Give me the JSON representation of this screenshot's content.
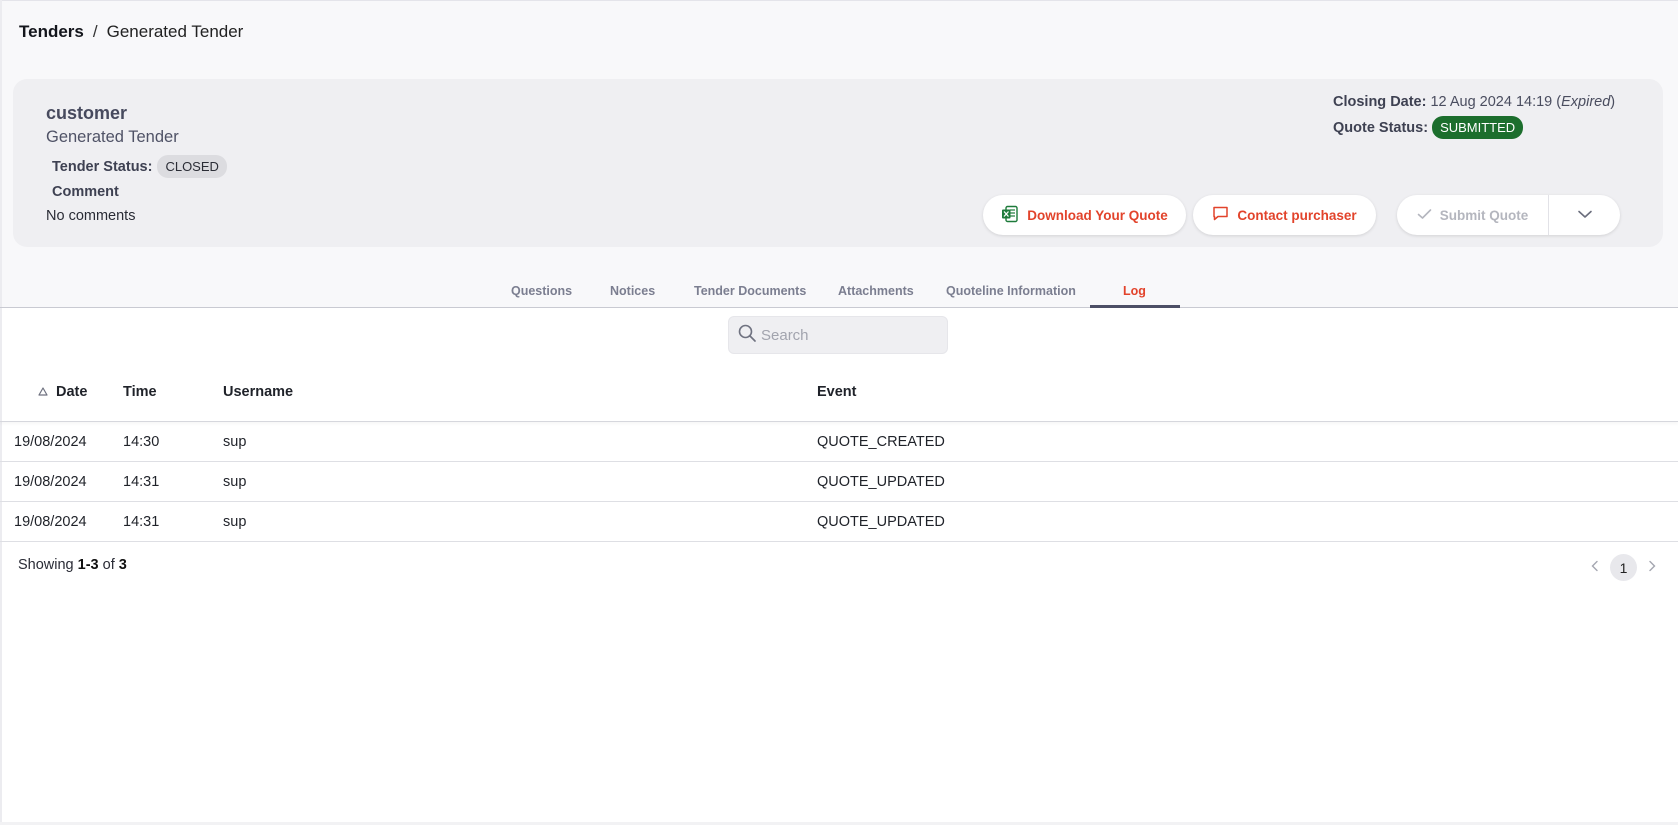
{
  "breadcrumb": {
    "root": "Tenders",
    "separator": "/",
    "current": "Generated Tender"
  },
  "header": {
    "customer": "customer",
    "tender_name": "Generated Tender",
    "tender_status_label": "Tender Status:",
    "tender_status": "CLOSED",
    "comment_label": "Comment",
    "comment_text": "No comments",
    "closing_date_label": "Closing Date:",
    "closing_date": "12 Aug 2024 14:19",
    "closing_open_paren": "(",
    "closing_state": "Expired",
    "closing_close_paren": ")",
    "quote_status_label": "Quote Status:",
    "quote_status": "SUBMITTED",
    "quote_status_color": "#1c6e2d"
  },
  "actions": {
    "download_label": "Download Your Quote",
    "download_icon": "excel-file-icon",
    "contact_label": "Contact purchaser",
    "contact_icon": "chat-bubble-icon",
    "submit_label": "Submit Quote",
    "submit_icon": "checkmark-icon",
    "more_icon": "chevron-down-icon",
    "accent_color": "#e2432b"
  },
  "tabs": [
    {
      "label": "Questions"
    },
    {
      "label": "Notices"
    },
    {
      "label": "Tender Documents"
    },
    {
      "label": "Attachments"
    },
    {
      "label": "Quoteline Information"
    },
    {
      "label": "Log",
      "active": true
    }
  ],
  "search": {
    "placeholder": "Search"
  },
  "table": {
    "columns": [
      "Date",
      "Time",
      "Username",
      "Event"
    ],
    "sort_column": "Date",
    "rows": [
      {
        "date": "19/08/2024",
        "time": "14:30",
        "username": "sup",
        "event": "QUOTE_CREATED"
      },
      {
        "date": "19/08/2024",
        "time": "14:31",
        "username": "sup",
        "event": "QUOTE_UPDATED"
      },
      {
        "date": "19/08/2024",
        "time": "14:31",
        "username": "sup",
        "event": "QUOTE_UPDATED"
      }
    ]
  },
  "footer": {
    "showing_prefix": "Showing",
    "showing_range": "1-3",
    "showing_of": "of",
    "showing_total": "3",
    "current_page": "1"
  }
}
